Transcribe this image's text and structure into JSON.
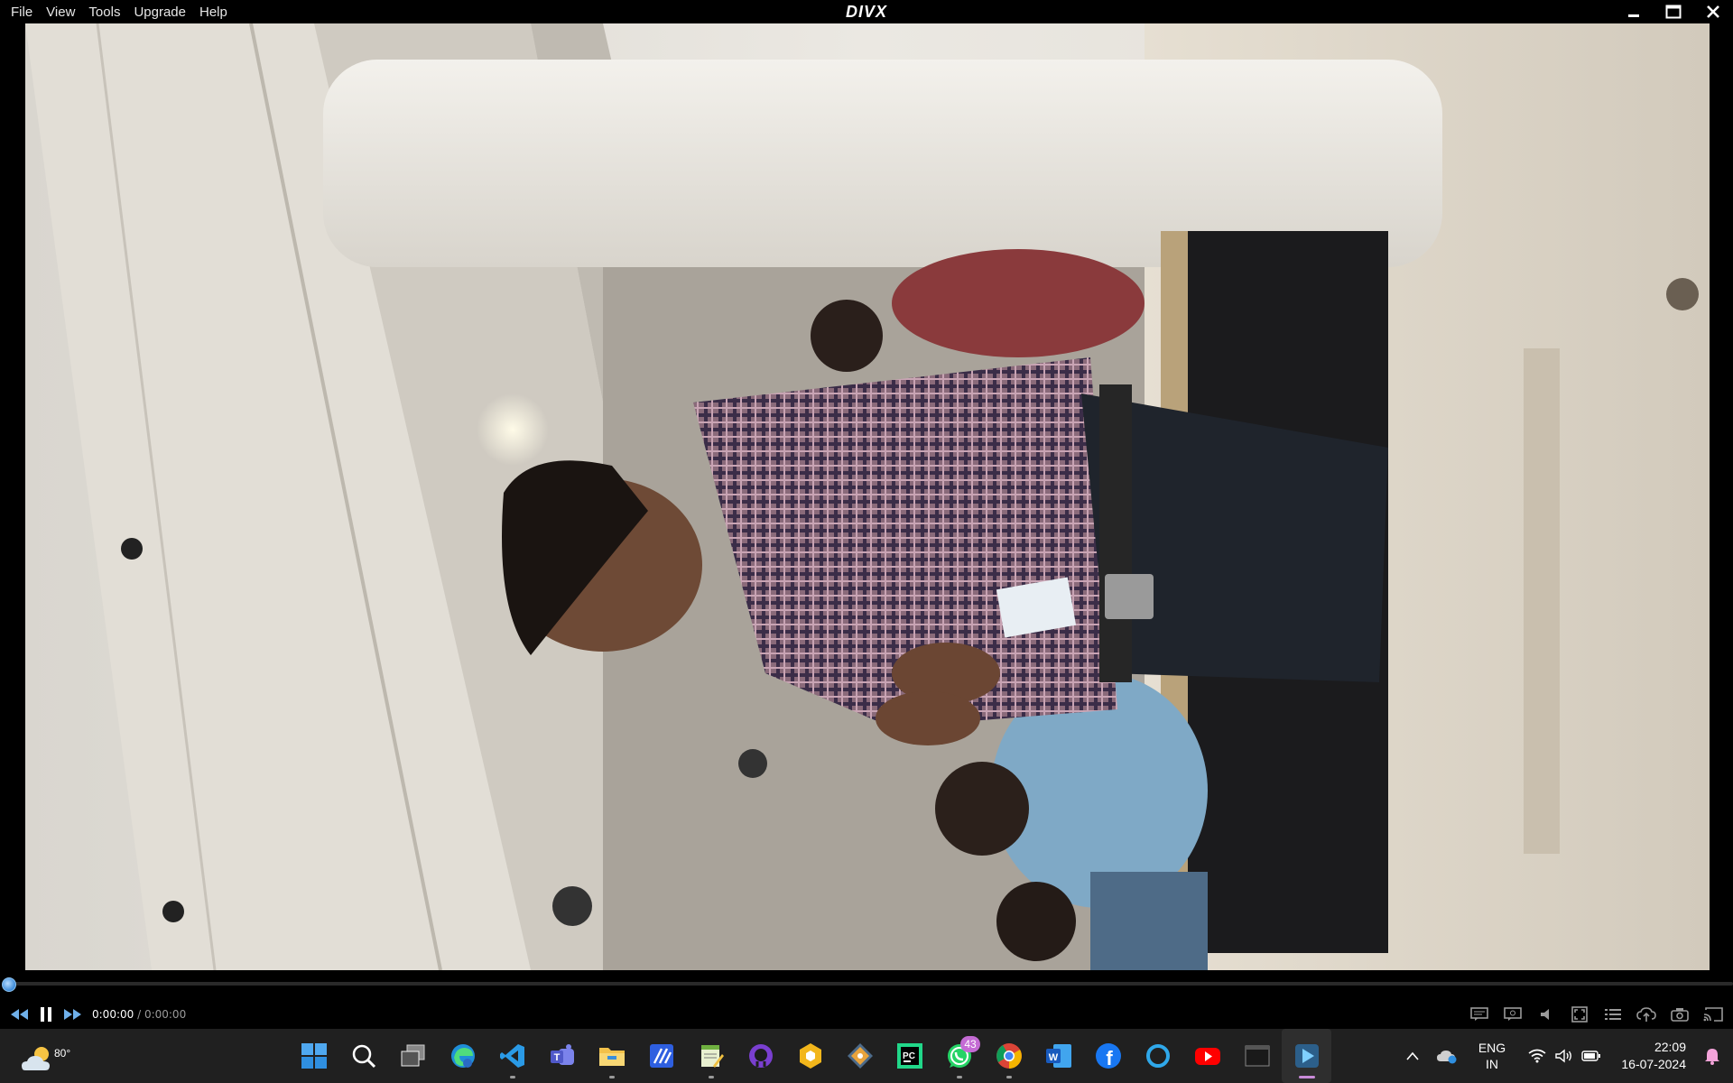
{
  "menu": {
    "items": [
      {
        "label": "File"
      },
      {
        "label": "View"
      },
      {
        "label": "Tools"
      },
      {
        "label": "Upgrade"
      },
      {
        "label": "Help"
      }
    ]
  },
  "app": {
    "logo_text": "DIVX",
    "logo_color": "#ffffff"
  },
  "window_controls": {
    "minimize_icon": "minimize-icon",
    "maximize_icon": "maximize-icon",
    "close_icon": "close-icon"
  },
  "player": {
    "progress": 0.0,
    "time_current": "0:00:00",
    "time_separator": " / ",
    "time_total": "0:00:00",
    "accent_color": "#3c8ad8"
  },
  "taskbar": {
    "weather": {
      "temp": "80°",
      "icon": "partly-cloudy-icon"
    },
    "apps": [
      {
        "name": "start",
        "icon": "windows-start-icon"
      },
      {
        "name": "search",
        "icon": "search-icon"
      },
      {
        "name": "task-view",
        "icon": "task-view-icon"
      },
      {
        "name": "edge",
        "icon": "edge-icon"
      },
      {
        "name": "vscode",
        "icon": "vscode-icon"
      },
      {
        "name": "teams",
        "icon": "teams-icon"
      },
      {
        "name": "file-explorer",
        "icon": "folder-icon"
      },
      {
        "name": "app-blue",
        "icon": "blue-app-icon"
      },
      {
        "name": "notepad-app",
        "icon": "notepad-icon"
      },
      {
        "name": "github-desktop",
        "icon": "github-icon"
      },
      {
        "name": "hex-app",
        "icon": "hexagon-app-icon"
      },
      {
        "name": "git-app",
        "icon": "git-diamond-icon"
      },
      {
        "name": "pycharm",
        "icon": "pycharm-icon"
      },
      {
        "name": "whatsapp",
        "icon": "whatsapp-icon",
        "badge": "43"
      },
      {
        "name": "chrome",
        "icon": "chrome-icon"
      },
      {
        "name": "word",
        "icon": "word-icon"
      },
      {
        "name": "facebook",
        "icon": "facebook-icon"
      },
      {
        "name": "cortana",
        "icon": "ring-icon"
      },
      {
        "name": "youtube",
        "icon": "youtube-icon"
      },
      {
        "name": "terminal",
        "icon": "terminal-icon"
      },
      {
        "name": "divx-player",
        "icon": "play-icon"
      }
    ],
    "tray": {
      "lang_line1": "ENG",
      "lang_line2": "IN",
      "time": "22:09",
      "date": "16-07-2024"
    }
  }
}
